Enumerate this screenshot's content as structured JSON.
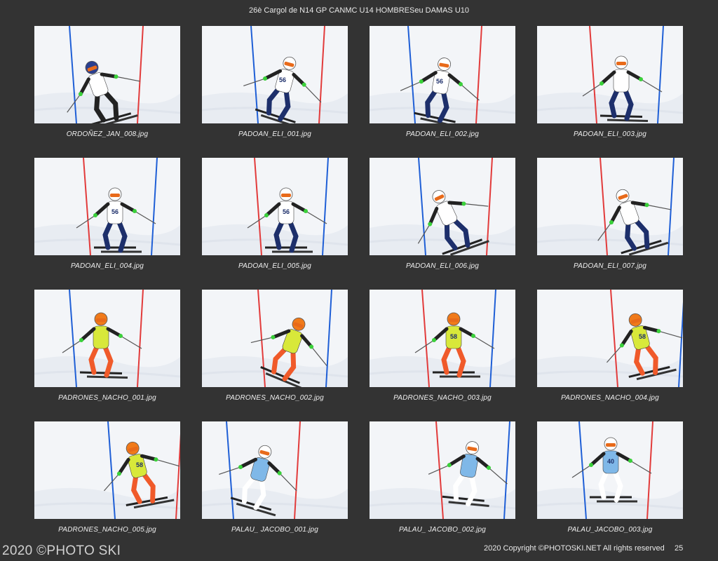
{
  "header": {
    "title": "26è Cargol de N14 GP CANMC U14 HOMBRESeu DAMAS U10"
  },
  "photos": [
    {
      "caption": "ORDOÑEZ_JAN_008.jpg",
      "bib": "",
      "helmet": "#2a3f8f",
      "jacket": "#ffffff",
      "accent": "#222222",
      "gate": "#1f5fd6"
    },
    {
      "caption": "PADOAN_ELI_001.jpg",
      "bib": "56",
      "helmet": "#ffffff",
      "jacket": "#ffffff",
      "accent": "#1d2f6b",
      "gate": "#1f5fd6"
    },
    {
      "caption": "PADOAN_ELI_002.jpg",
      "bib": "56",
      "helmet": "#ffffff",
      "jacket": "#ffffff",
      "accent": "#1d2f6b",
      "gate": "#1f5fd6"
    },
    {
      "caption": "PADOAN_ELI_003.jpg",
      "bib": "",
      "helmet": "#ffffff",
      "jacket": "#ffffff",
      "accent": "#1d2f6b",
      "gate": "#e23b3b"
    },
    {
      "caption": "PADOAN_ELI_004.jpg",
      "bib": "56",
      "helmet": "#ffffff",
      "jacket": "#ffffff",
      "accent": "#1d2f6b",
      "gate": "#e23b3b"
    },
    {
      "caption": "PADOAN_ELI_005.jpg",
      "bib": "56",
      "helmet": "#ffffff",
      "jacket": "#ffffff",
      "accent": "#1d2f6b",
      "gate": "#e23b3b"
    },
    {
      "caption": "PADOAN_ELI_006.jpg",
      "bib": "",
      "helmet": "#ffffff",
      "jacket": "#ffffff",
      "accent": "#1d2f6b",
      "gate": "#1f5fd6"
    },
    {
      "caption": "PADOAN_ELI_007.jpg",
      "bib": "",
      "helmet": "#ffffff",
      "jacket": "#ffffff",
      "accent": "#1d2f6b",
      "gate": "#e23b3b"
    },
    {
      "caption": "PADRONES_NACHO_001.jpg",
      "bib": "",
      "helmet": "#f07a1a",
      "jacket": "#d8e83a",
      "accent": "#f05a2a",
      "gate": "#1f5fd6"
    },
    {
      "caption": "PADRONES_NACHO_002.jpg",
      "bib": "",
      "helmet": "#f07a1a",
      "jacket": "#d8e83a",
      "accent": "#f05a2a",
      "gate": "#e23b3b"
    },
    {
      "caption": "PADRONES_NACHO_003.jpg",
      "bib": "58",
      "helmet": "#f07a1a",
      "jacket": "#d8e83a",
      "accent": "#f05a2a",
      "gate": "#e23b3b"
    },
    {
      "caption": "PADRONES_NACHO_004.jpg",
      "bib": "58",
      "helmet": "#f07a1a",
      "jacket": "#d8e83a",
      "accent": "#f05a2a",
      "gate": "#e23b3b"
    },
    {
      "caption": "PADRONES_NACHO_005.jpg",
      "bib": "58",
      "helmet": "#f07a1a",
      "jacket": "#d8e83a",
      "accent": "#f05a2a",
      "gate": "#1f5fd6"
    },
    {
      "caption": "PALAU_ JACOBO_001.jpg",
      "bib": "",
      "helmet": "#ffffff",
      "jacket": "#7fb8e8",
      "accent": "#ffffff",
      "gate": "#1f5fd6"
    },
    {
      "caption": "PALAU_ JACOBO_002.jpg",
      "bib": "",
      "helmet": "#ffffff",
      "jacket": "#7fb8e8",
      "accent": "#ffffff",
      "gate": "#e23b3b"
    },
    {
      "caption": "PALAU_JACOBO_003.jpg",
      "bib": "40",
      "helmet": "#ffffff",
      "jacket": "#7fb8e8",
      "accent": "#ffffff",
      "gate": "#1f5fd6"
    }
  ],
  "footer": {
    "watermark": "2020 ©PHOTO SKI",
    "copyright": "2020 Copyright ©PHOTOSKI.NET All rights reserved",
    "page": "25"
  }
}
